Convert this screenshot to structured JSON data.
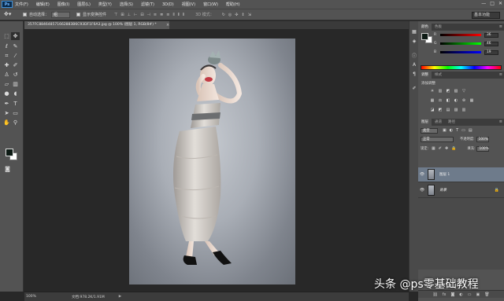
{
  "menubar": {
    "logo": "Ps",
    "items": [
      "文件(F)",
      "编辑(E)",
      "图像(I)",
      "图层(L)",
      "类型(Y)",
      "选择(S)",
      "滤镜(T)",
      "3D(D)",
      "视图(V)",
      "窗口(W)",
      "帮助(H)"
    ],
    "window_controls": [
      "—",
      "□",
      "✕"
    ]
  },
  "options": {
    "auto_select_label": "自动选择：",
    "auto_select_value": "组",
    "show_transform_label": "显示变换控件",
    "mode_3d_label": "3D 模式：",
    "workspace": "基本功能"
  },
  "document": {
    "tab_title": "357FC884648571662883B6C93DF1F6A3.jpg @ 100% (图层 1, RGB/8#) *",
    "tab_close": "×",
    "zoom": "100%",
    "doc_info": "文档:978.2K/1.91M",
    "status_arrow": "▶"
  },
  "color_panel": {
    "tabs": [
      "颜色",
      "色板"
    ],
    "sliders": [
      {
        "label": "R",
        "value": "36",
        "gradient": [
          "#000000",
          "#ff0000"
        ]
      },
      {
        "label": "G",
        "value": "46",
        "gradient": [
          "#000000",
          "#00ff00"
        ]
      },
      {
        "label": "B",
        "value": "19",
        "gradient": [
          "#000000",
          "#0000ff"
        ]
      }
    ],
    "foreground": "#0d1a14",
    "background": "#ffffff"
  },
  "adjustments_panel": {
    "tabs": [
      "调整",
      "样式"
    ],
    "title": "添加调整",
    "row1": [
      "☀",
      "▥",
      "◩",
      "▧",
      "▽"
    ],
    "row2": [
      "▦",
      "⚖",
      "◧",
      "◐",
      "⊛",
      "▦"
    ],
    "row3": [
      "◪",
      "◩",
      "▤",
      "▨",
      "▥"
    ]
  },
  "layers_panel": {
    "tabs": [
      "图层",
      "通道",
      "路径"
    ],
    "kind_filter": "类型",
    "blend_mode": "正常",
    "opacity_label": "不透明度:",
    "opacity_value": "100%",
    "lock_label": "锁定:",
    "fill_label": "填充:",
    "fill_value": "100%",
    "layers": [
      {
        "name": "图层 1",
        "selected": true,
        "italic": false
      },
      {
        "name": "背景",
        "selected": false,
        "italic": true
      }
    ],
    "footer_icons": [
      "⛓",
      "fx",
      "◙",
      "◐",
      "▭",
      "▣",
      "🗑"
    ]
  },
  "watermark": "头条 @ps零基础教程"
}
